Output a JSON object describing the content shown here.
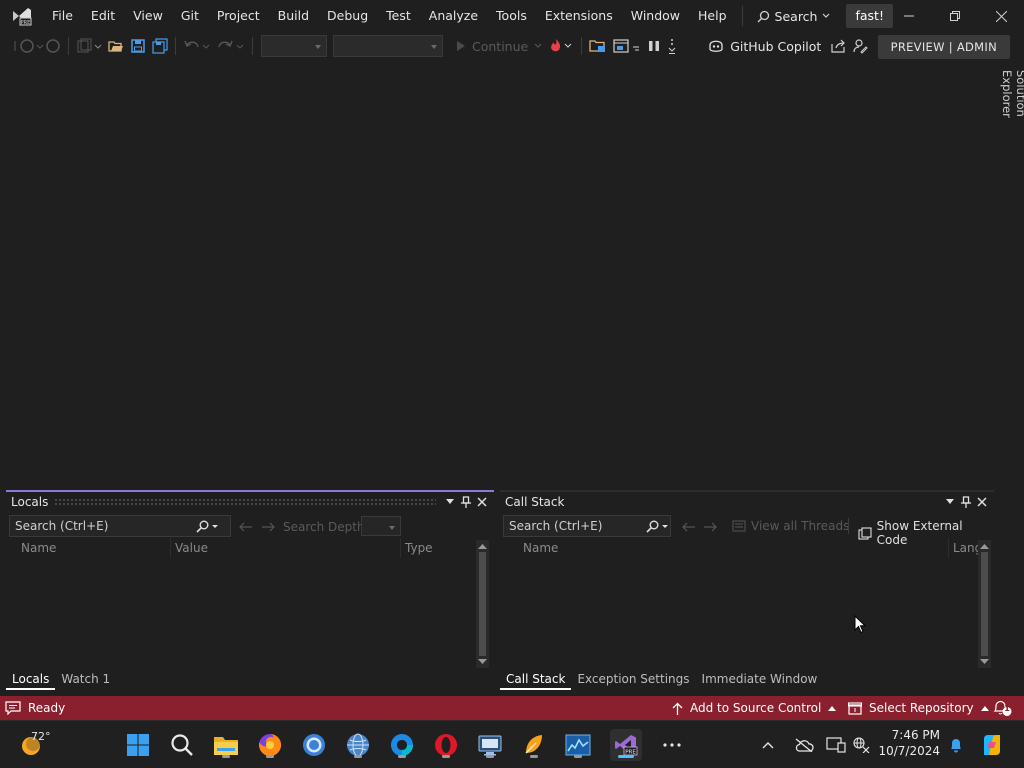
{
  "menu": {
    "items": [
      "File",
      "Edit",
      "View",
      "Git",
      "Project",
      "Build",
      "Debug",
      "Test",
      "Analyze",
      "Tools",
      "Extensions",
      "Window",
      "Help"
    ],
    "search_label": "Search",
    "solution_name": "fast!"
  },
  "toolbar": {
    "continue_label": "Continue",
    "copilot_label": "GitHub Copilot",
    "preview_label": "PREVIEW | ADMIN"
  },
  "right_dock": {
    "solution_explorer": "Solution Explorer"
  },
  "locals_panel": {
    "title": "Locals",
    "search_placeholder": "Search (Ctrl+E)",
    "search_depth_label": "Search Depth:",
    "columns": [
      "Name",
      "Value",
      "Type"
    ],
    "tabs": [
      "Locals",
      "Watch 1"
    ]
  },
  "callstack_panel": {
    "title": "Call Stack",
    "search_placeholder": "Search (Ctrl+E)",
    "view_threads_label": "View all Threads",
    "show_external_label": "Show External Code",
    "columns": [
      "Name",
      "Lang"
    ],
    "tabs": [
      "Call Stack",
      "Exception Settings",
      "Immediate Window"
    ]
  },
  "statusbar": {
    "ready": "Ready",
    "add_source_control": "Add to Source Control",
    "select_repository": "Select Repository",
    "notification_count": "1"
  },
  "taskbar": {
    "weather_temp": "72°",
    "time": "7:46 PM",
    "date": "10/7/2024"
  },
  "colors": {
    "accent": "#8a1f2e",
    "background": "#1f1f1f",
    "vs_purple": "#9b6ad6"
  }
}
